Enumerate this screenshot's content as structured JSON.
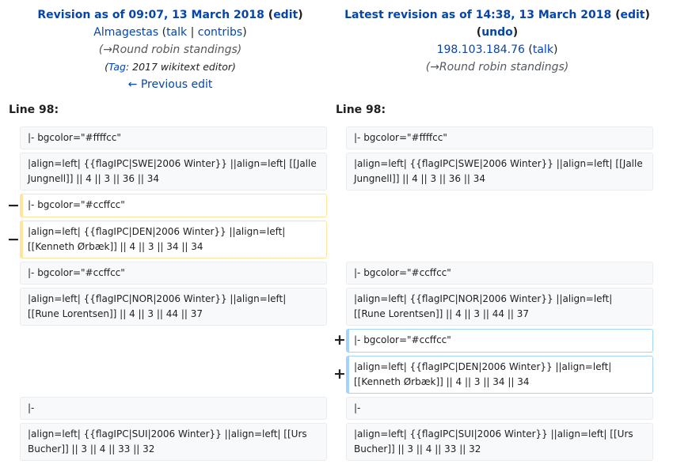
{
  "left": {
    "revision_label": "Revision as of 09:07, 13 March 2018",
    "edit": "edit",
    "user": "Almagestas",
    "talk": "talk",
    "contribs": "contribs",
    "summary": "(→Round robin standings)",
    "tag_prefix": "(",
    "tag_link": "Tag",
    "tag_rest": ": 2017 wikitext editor)",
    "prev_edit": "← Previous edit",
    "line": "Line 98:"
  },
  "right": {
    "revision_label": "Latest revision as of 14:38, 13 March 2018",
    "edit": "edit",
    "undo": "undo",
    "user": "198.103.184.76",
    "talk": "talk",
    "summary": "(→Round robin standings)",
    "line": "Line 98:"
  },
  "markers": {
    "minus": "−",
    "plus": "+"
  },
  "diff": {
    "ctx1": "|- bgcolor=\"#ffffcc\"",
    "ctx2": "|align=left| {{flagIPC|SWE|2006 Winter}} ||align=left| [[Jalle Jungnell]] || 4 || 3 || 36 || 34",
    "del1": "|- bgcolor=\"#ccffcc\"",
    "del2": "|align=left| {{flagIPC|DEN|2006 Winter}} ||align=left| [[Kenneth Ørbæk]] || 4 || 3 || 34 || 34",
    "ctx3": "|- bgcolor=\"#ccffcc\"",
    "ctx4": "|align=left| {{flagIPC|NOR|2006 Winter}} ||align=left| [[Rune Lorentsen]] || 4 || 3 || 44 || 37",
    "add1": "|- bgcolor=\"#ccffcc\"",
    "add2": "|align=left| {{flagIPC|DEN|2006 Winter}} ||align=left| [[Kenneth Ørbæk]] || 4 || 3 || 34 || 34",
    "ctx5": "|-",
    "ctx6": "|align=left| {{flagIPC|SUI|2006 Winter}} ||align=left| [[Urs Bucher]] || 3 || 4 || 33 || 32"
  }
}
